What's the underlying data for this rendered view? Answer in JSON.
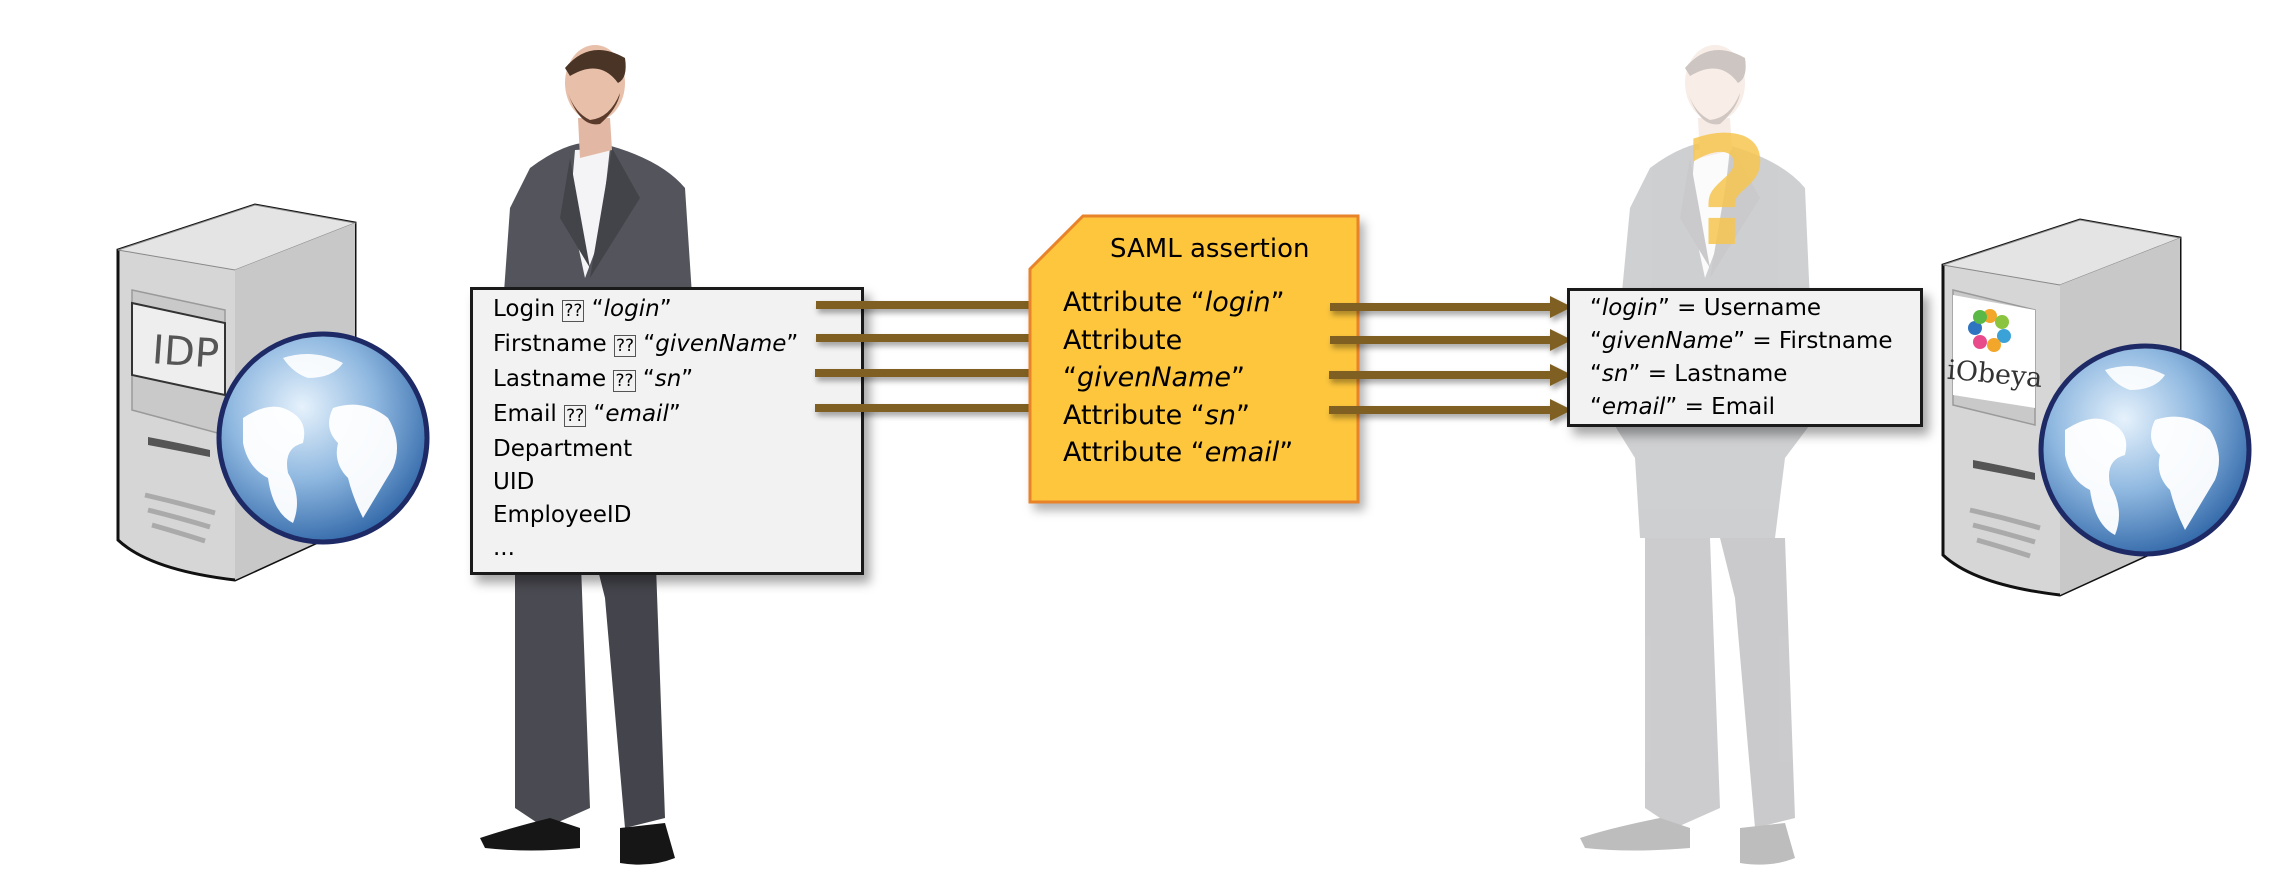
{
  "colors": {
    "arrow": "#7f6121",
    "saml_fill": "#fdc63c",
    "saml_stroke": "#e8832a",
    "box_fill": "#f2f2f2",
    "question_mark": "#f6c64f"
  },
  "idp_server": {
    "label": "IDP",
    "icon": "server-globe-icon"
  },
  "sp_server": {
    "label": "iObeya",
    "icon": "server-globe-icon"
  },
  "user_attributes": {
    "lines": [
      {
        "key": "Login",
        "sep": "??",
        "open": "“",
        "value": "login",
        "close": "”"
      },
      {
        "key": "Firstname",
        "sep": "??",
        "open": "“",
        "value": "givenName",
        "close": "”"
      },
      {
        "key": "Lastname",
        "sep": "??",
        "open": "“",
        "value": "sn",
        "close": "”"
      },
      {
        "key": "Email",
        "sep": "??",
        "open": "“",
        "value": "email",
        "close": "”"
      }
    ],
    "extra": [
      "Department",
      "UID",
      "EmployeeID",
      "..."
    ]
  },
  "saml": {
    "title": "SAML assertion",
    "lines": [
      {
        "pre": "Attribute “",
        "value": "login",
        "post": "”"
      },
      {
        "pre": "Attribute",
        "value": "",
        "post": ""
      },
      {
        "pre": "“",
        "value": "givenName",
        "post": "”"
      },
      {
        "pre": "Attribute “",
        "value": "sn",
        "post": "”"
      },
      {
        "pre": "Attribute “",
        "value": "email",
        "post": "”"
      }
    ]
  },
  "mapping": {
    "lines": [
      {
        "open": "“",
        "value": "login",
        "close": "”",
        "rest": " = Username"
      },
      {
        "open": "“",
        "value": "givenName",
        "close": "”",
        "rest": " = Firstname"
      },
      {
        "open": "“",
        "value": "sn",
        "close": "”",
        "rest": " = Lastname"
      },
      {
        "open": "“",
        "value": "email",
        "close": "”",
        "rest": " = Email"
      }
    ]
  },
  "unknown_user": {
    "symbol": "?"
  }
}
